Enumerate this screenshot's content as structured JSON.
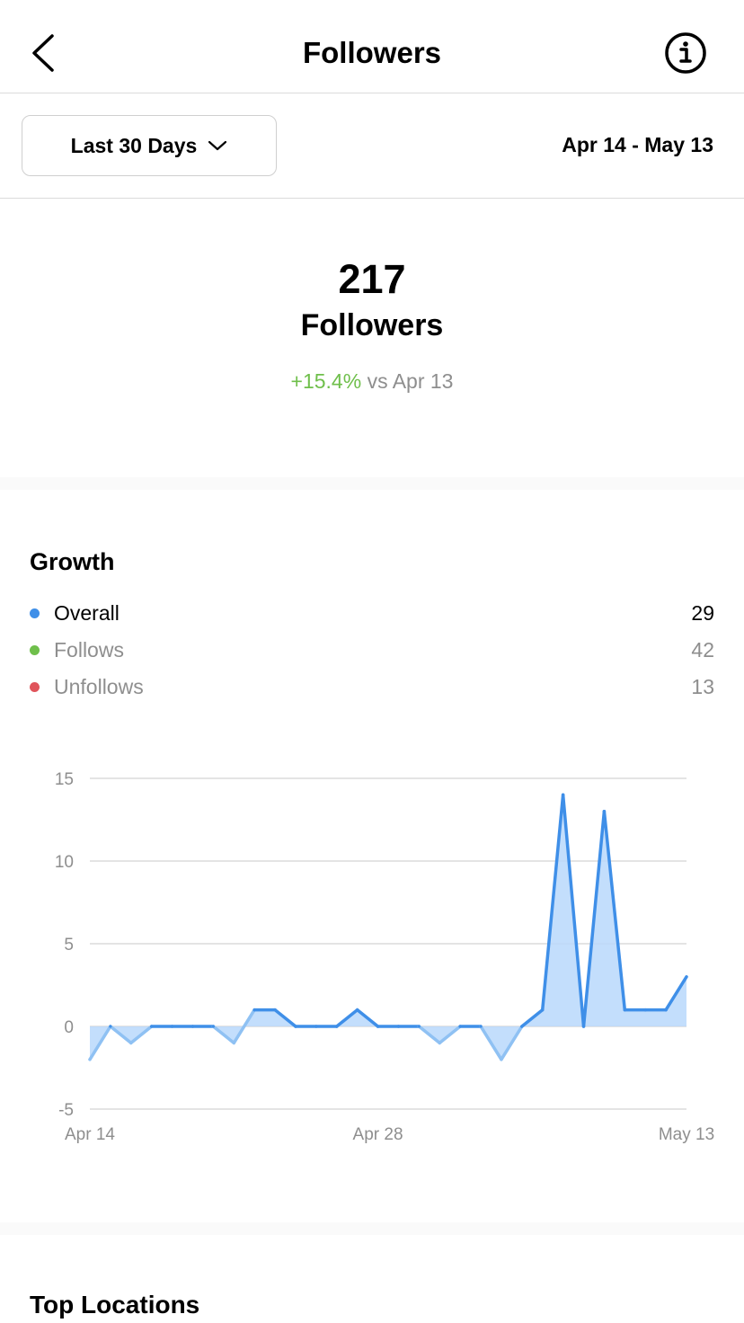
{
  "header": {
    "title": "Followers",
    "back_icon": "chevron-left-icon",
    "info_icon": "info-icon"
  },
  "range": {
    "selected": "Last 30 Days",
    "dates": "Apr 14 - May 13"
  },
  "summary": {
    "count": "217",
    "label": "Followers",
    "change_pct": "+15.4%",
    "change_suffix": " vs Apr 13"
  },
  "growth": {
    "title": "Growth",
    "legend": [
      {
        "name": "Overall",
        "value": "29",
        "color": "#3f8fe8",
        "text_color": "#000000"
      },
      {
        "name": "Follows",
        "value": "42",
        "color": "#6fbf4b",
        "text_color": "#8e8e8e"
      },
      {
        "name": "Unfollows",
        "value": "13",
        "color": "#e0545b",
        "text_color": "#8e8e8e"
      }
    ]
  },
  "chart_data": {
    "type": "area",
    "x_tick_labels": [
      "Apr 14",
      "Apr 28",
      "May 13"
    ],
    "y_ticks": [
      "15",
      "10",
      "5",
      "0",
      "-5"
    ],
    "ylim": [
      -5,
      15
    ],
    "grid": true,
    "series": [
      {
        "name": "Overall",
        "color": "#3f8fe8",
        "values": [
          -2,
          0,
          -1,
          0,
          0,
          0,
          0,
          -1,
          1,
          1,
          0,
          0,
          0,
          1,
          0,
          0,
          0,
          -1,
          0,
          0,
          -2,
          0,
          1,
          14,
          0,
          13,
          1,
          1,
          1,
          3
        ]
      }
    ]
  },
  "bottom": {
    "title": "Top Locations"
  }
}
